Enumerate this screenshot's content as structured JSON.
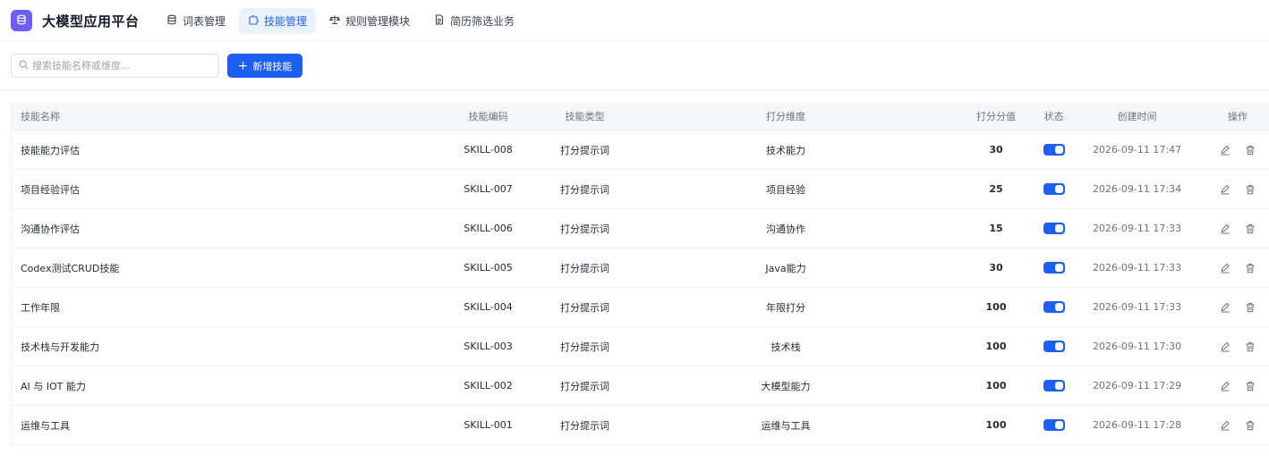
{
  "app": {
    "title": "大模型应用平台",
    "logo_icon": "database-icon"
  },
  "nav": {
    "tabs": [
      {
        "label": "词表管理",
        "icon": "database-icon",
        "active": false
      },
      {
        "label": "技能管理",
        "icon": "puzzle-icon",
        "active": true
      },
      {
        "label": "规则管理模块",
        "icon": "scale-icon",
        "active": false
      },
      {
        "label": "简历筛选业务",
        "icon": "document-icon",
        "active": false
      }
    ]
  },
  "toolbar": {
    "search_placeholder": "搜索技能名称或维度...",
    "add_label": "新增技能",
    "add_icon": "+"
  },
  "table": {
    "headers": {
      "name": "技能名称",
      "code": "技能编码",
      "type": "技能类型",
      "dimension": "打分维度",
      "score": "打分分值",
      "status": "状态",
      "created": "创建时间",
      "ops": "操作"
    },
    "rows": [
      {
        "name": "技能能力评估",
        "code": "SKILL-008",
        "type": "打分提示词",
        "dimension": "技术能力",
        "score": "30",
        "status_on": true,
        "created": "2026-09-11 17:47"
      },
      {
        "name": "项目经验评估",
        "code": "SKILL-007",
        "type": "打分提示词",
        "dimension": "项目经验",
        "score": "25",
        "status_on": true,
        "created": "2026-09-11 17:34"
      },
      {
        "name": "沟通协作评估",
        "code": "SKILL-006",
        "type": "打分提示词",
        "dimension": "沟通协作",
        "score": "15",
        "status_on": true,
        "created": "2026-09-11 17:33"
      },
      {
        "name": "Codex测试CRUD技能",
        "code": "SKILL-005",
        "type": "打分提示词",
        "dimension": "Java能力",
        "score": "30",
        "status_on": true,
        "created": "2026-09-11 17:33"
      },
      {
        "name": "工作年限",
        "code": "SKILL-004",
        "type": "打分提示词",
        "dimension": "年限打分",
        "score": "100",
        "status_on": true,
        "created": "2026-09-11 17:33"
      },
      {
        "name": "技术栈与开发能力",
        "code": "SKILL-003",
        "type": "打分提示词",
        "dimension": "技术栈",
        "score": "100",
        "status_on": true,
        "created": "2026-09-11 17:30"
      },
      {
        "name": "AI 与 IOT 能力",
        "code": "SKILL-002",
        "type": "打分提示词",
        "dimension": "大模型能力",
        "score": "100",
        "status_on": true,
        "created": "2026-09-11 17:29"
      },
      {
        "name": "运维与工具",
        "code": "SKILL-001",
        "type": "打分提示词",
        "dimension": "运维与工具",
        "score": "100",
        "status_on": true,
        "created": "2026-09-11 17:28"
      }
    ]
  },
  "colors": {
    "accent": "#1d5ff0",
    "logo": "#6d5ef5",
    "active_tab_bg": "#eaf1ff"
  }
}
